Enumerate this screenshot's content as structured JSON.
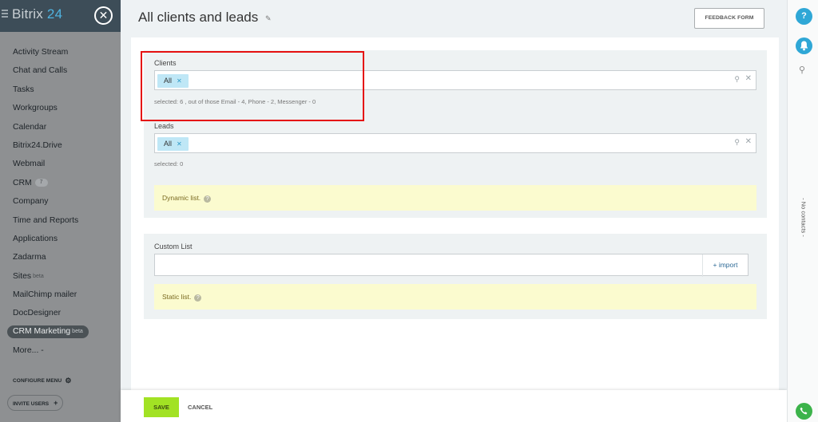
{
  "sidebar": {
    "logo_text": "Bitrix",
    "logo_num": "24",
    "menu": [
      {
        "label": "Activity Stream"
      },
      {
        "label": "Chat and Calls"
      },
      {
        "label": "Tasks"
      },
      {
        "label": "Workgroups"
      },
      {
        "label": "Calendar"
      },
      {
        "label": "Bitrix24.Drive"
      },
      {
        "label": "Webmail"
      },
      {
        "label": "CRM",
        "count": "7"
      },
      {
        "label": "Company"
      },
      {
        "label": "Time and Reports"
      },
      {
        "label": "Applications"
      },
      {
        "label": "Zadarma"
      },
      {
        "label": "Sites",
        "sup": "beta"
      },
      {
        "label": "MailChimp mailer"
      },
      {
        "label": "DocDesigner"
      },
      {
        "label": "CRM Marketing",
        "sup": "beta",
        "active": true
      },
      {
        "label": "More... -"
      }
    ],
    "configure_menu": "CONFIGURE MENU",
    "invite_users": "INVITE USERS"
  },
  "header": {
    "title": "All clients and leads",
    "feedback_button": "FEEDBACK FORM"
  },
  "clients": {
    "label": "Clients",
    "tag": "All",
    "selected_note": "selected:  6 , out of those Email - 4, Phone - 2, Messenger - 0"
  },
  "leads": {
    "label": "Leads",
    "tag": "All",
    "selected_note": "selected:  0"
  },
  "dynamic_note": "Dynamic list.",
  "custom_list": {
    "label": "Custom List",
    "import_label": "+ import",
    "static_note": "Static list."
  },
  "footer": {
    "save": "SAVE",
    "cancel": "CANCEL"
  },
  "rightbar": {
    "help": "?",
    "no_contacts": "- No contacts -"
  },
  "colors": {
    "save_button": "#a2e224",
    "tag_bg": "#bfe7f6",
    "highlight_box": "#e51010",
    "accent": "#2fa7d6"
  }
}
